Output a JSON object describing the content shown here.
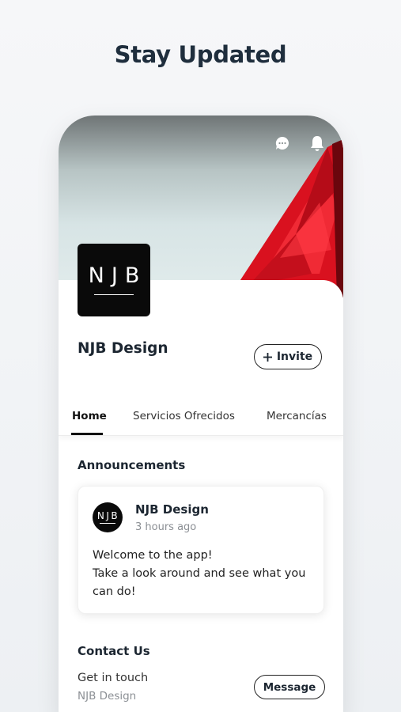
{
  "page": {
    "heading": "Stay Updated"
  },
  "header": {
    "icons": [
      "chat-icon",
      "bell-icon"
    ]
  },
  "business": {
    "logo_text": "NJB",
    "name": "NJB Design",
    "invite_label": "Invite"
  },
  "tabs": [
    {
      "label": "Home",
      "active": true
    },
    {
      "label": "Servicios Ofrecidos",
      "active": false
    },
    {
      "label": "Mercancías",
      "active": false
    }
  ],
  "announcements": {
    "title": "Announcements",
    "post": {
      "author": "NJB Design",
      "time": "3 hours ago",
      "body_line1": "Welcome to the app!",
      "body_line2": "Take a look around and see what you can do!"
    }
  },
  "contact": {
    "title": "Contact Us",
    "label": "Get in touch",
    "subtitle": "NJB Design",
    "message_label": "Message"
  },
  "colors": {
    "accent_red": "#e8172a",
    "text_dark": "#1c2631",
    "muted": "#8b8f94"
  }
}
